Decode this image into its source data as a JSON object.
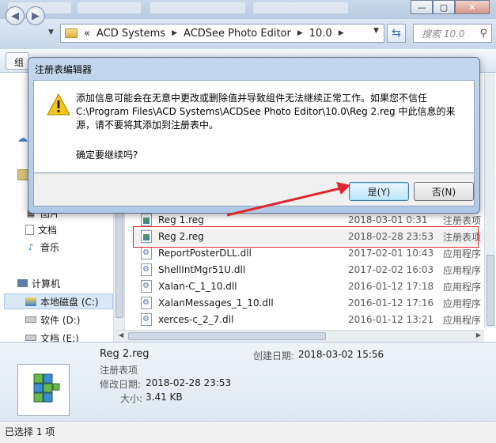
{
  "explorer": {
    "breadcrumb_prefix": "«",
    "breadcrumb": [
      "ACD Systems",
      "ACDSee Photo Editor",
      "10.0"
    ],
    "search_placeholder": "搜索 10.0",
    "nav": {
      "partial_top": "图片",
      "docs": "文档",
      "music": "音乐",
      "computer": "计算机",
      "local_disk": "本地磁盘 (C:)",
      "software": "软件 (D:)",
      "documents": "文档 (E:)"
    },
    "files": [
      {
        "name": "Reg 1.reg",
        "date": "2018-03-01 0:31",
        "type": "注册表项",
        "kind": "reg"
      },
      {
        "name": "Reg 2.reg",
        "date": "2018-02-28 23:53",
        "type": "注册表项",
        "kind": "reg"
      },
      {
        "name": "ReportPosterDLL.dll",
        "date": "2017-02-01 10:43",
        "type": "应用程序",
        "kind": "dll"
      },
      {
        "name": "ShellIntMgr51U.dll",
        "date": "2017-02-02 16:03",
        "type": "应用程序",
        "kind": "dll"
      },
      {
        "name": "Xalan-C_1_10.dll",
        "date": "2016-01-12 17:18",
        "type": "应用程序",
        "kind": "dll"
      },
      {
        "name": "XalanMessages_1_10.dll",
        "date": "2016-01-12 17:16",
        "type": "应用程序",
        "kind": "dll"
      },
      {
        "name": "xerces-c_2_7.dll",
        "date": "2016-01-12 13:21",
        "type": "应用程序",
        "kind": "dll"
      }
    ],
    "details": {
      "filename": "Reg 2.reg",
      "filetype": "注册表项",
      "modified_label": "修改日期:",
      "modified": "2018-02-28 23:53",
      "created_label": "创建日期:",
      "created": "2018-03-02 15:56",
      "size_label": "大小:",
      "size": "3.41 KB"
    },
    "status": "已选择 1 项"
  },
  "dialog": {
    "title": "注册表编辑器",
    "message": "添加信息可能会在无意中更改或删除值并导致组件无法继续正常工作。如果您不信任 C:\\Program Files\\ACD Systems\\ACDSee Photo Editor\\10.0\\Reg 2.reg 中此信息的来源，请不要将其添加到注册表中。",
    "confirm": "确定要继续吗?",
    "yes_label": "是(Y)",
    "no_label": "否(N)"
  },
  "colors": {
    "annotation_red": "#e0252c",
    "dialog_frame": "#b0c9e6",
    "warning_yellow": "#f5c518"
  },
  "icons": [
    "minimize-icon",
    "maximize-icon",
    "close-icon",
    "back-icon",
    "forward-icon",
    "folder-icon",
    "refresh-icon",
    "search-icon",
    "warning-icon",
    "registry-file-icon",
    "dll-file-icon",
    "computer-icon",
    "drive-icon",
    "music-icon",
    "document-icon"
  ]
}
